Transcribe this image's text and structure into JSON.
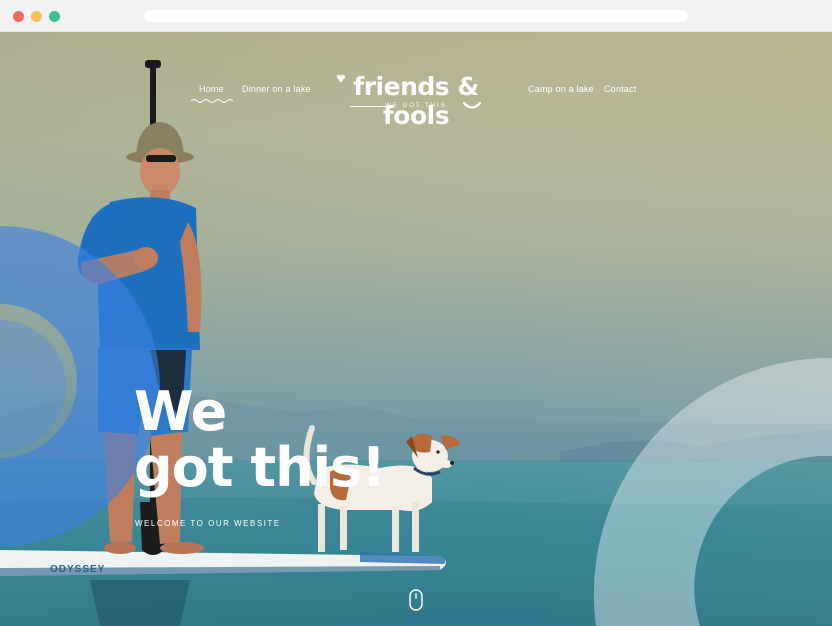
{
  "nav": {
    "home": "Home",
    "dinner": "Dinner on a lake",
    "camp": "Camp on a lake",
    "contact": "Contact"
  },
  "logo": {
    "name": "friends & fools",
    "tagline": "WE GOT THIS"
  },
  "hero": {
    "headline_line1": "We",
    "headline_line2": "got this!",
    "subheading": "WELCOME TO OUR WEBSITE",
    "board_text": "ODYSSEY"
  },
  "colors": {
    "accent_blue": "#3b7fe0",
    "white": "#ffffff",
    "window_red": "#ef6a5e",
    "window_yellow": "#f2c35b",
    "window_green": "#3ebf8d"
  },
  "icons": {
    "scroll": "mouse-scroll-icon",
    "leaf": "leaf-icon",
    "smile": "smile-icon"
  }
}
